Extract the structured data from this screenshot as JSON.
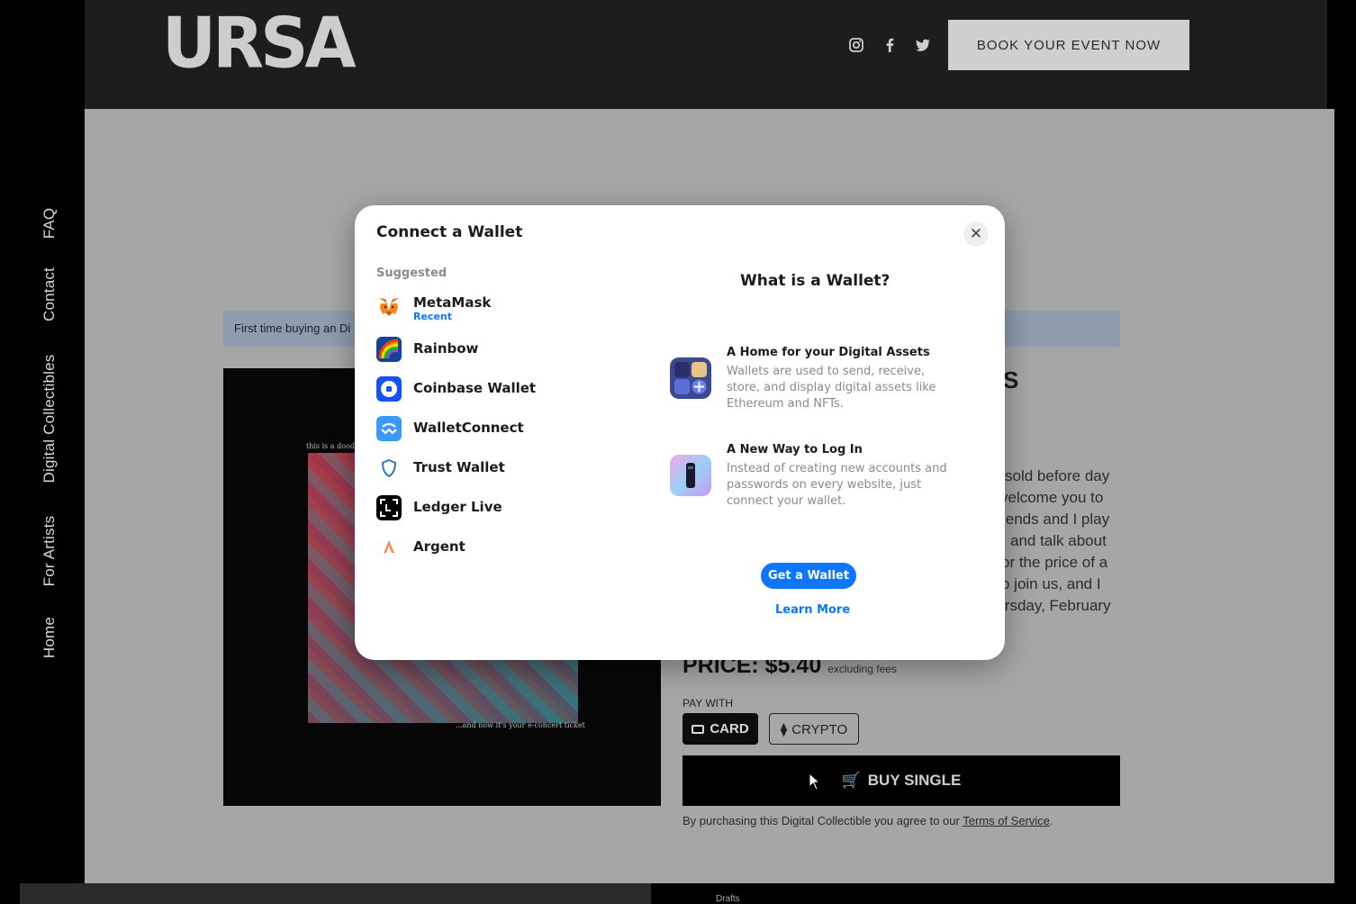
{
  "sidebar": {
    "items": [
      "Home",
      "For Artists",
      "Digital Collectibles",
      "Contact",
      "FAQ"
    ]
  },
  "header": {
    "logo": "URSA",
    "social": [
      "instagram-icon",
      "facebook-icon",
      "twitter-icon"
    ],
    "cta": "BOOK YOUR EVENT NOW"
  },
  "page": {
    "info_banner": "First time buying an Di",
    "heading_partial": "S",
    "description_fragments": [
      "sold before day",
      "velcome you to",
      "iends and I play",
      "and talk about",
      "or the price of a",
      "o join us, and I",
      "irsday, February"
    ],
    "art_caption_top": "this is a doodl",
    "art_caption_bottom": "...and now it's your e-concert ticket",
    "price_label": "PRICE: $5.40",
    "price_note": "excluding fees",
    "pay_with": "PAY WITH",
    "card_label": "CARD",
    "crypto_label": "CRYPTO",
    "buy_label": "BUY SINGLE",
    "terms_prefix": "By purchasing this Digital Collectible you agree to our ",
    "terms_link": "Terms of Service",
    "terms_suffix": ".",
    "bottom_drafts": "Drafts"
  },
  "modal": {
    "title": "Connect a Wallet",
    "close": "✕",
    "suggested": "Suggested",
    "wallets": [
      {
        "name": "MetaMask",
        "badge": "Recent"
      },
      {
        "name": "Rainbow"
      },
      {
        "name": "Coinbase Wallet"
      },
      {
        "name": "WalletConnect"
      },
      {
        "name": "Trust Wallet"
      },
      {
        "name": "Ledger Live"
      },
      {
        "name": "Argent"
      }
    ],
    "what_title": "What is a Wallet?",
    "features": [
      {
        "title": "A Home for your Digital Assets",
        "text": "Wallets are used to send, receive, store, and display digital assets like Ethereum and NFTs."
      },
      {
        "title": "A New Way to Log In",
        "text": "Instead of creating new accounts and passwords on every website, just connect your wallet."
      }
    ],
    "get_wallet": "Get a Wallet",
    "learn_more": "Learn More"
  },
  "colors": {
    "accent": "#0e76fd",
    "header_bg": "#1d1d1d",
    "overlay_bg": "#a6a6a6"
  }
}
